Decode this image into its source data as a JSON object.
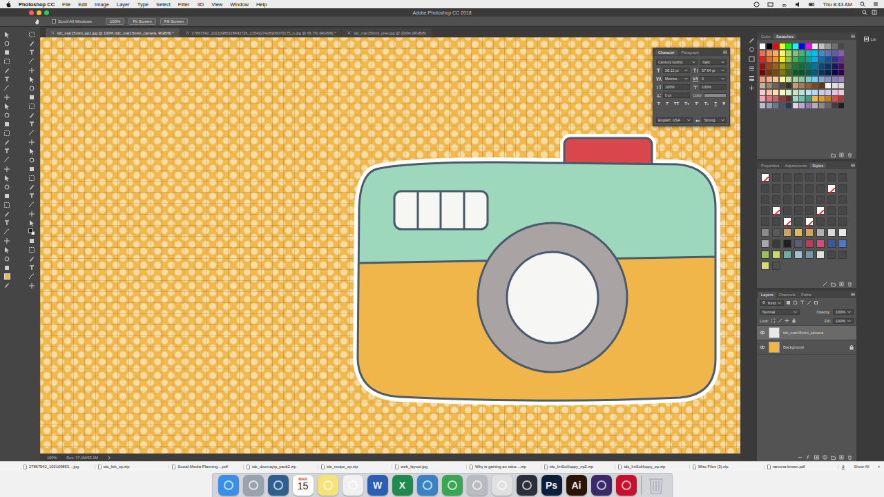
{
  "menubar": {
    "app": "Photoshop CC",
    "menus": [
      "File",
      "Edit",
      "Image",
      "Layer",
      "Type",
      "Select",
      "Filter",
      "3D",
      "View",
      "Window",
      "Help"
    ],
    "clock": "Thu 8:43 AM"
  },
  "window": {
    "title": "Adobe Photoshop CC 2018"
  },
  "options": {
    "scroll_all": {
      "label": "Scroll All Windows",
      "checked": false
    },
    "buttons": [
      "100%",
      "Fit Screen",
      "Fill Screen"
    ]
  },
  "tabs": [
    {
      "label": "tdc_mar15mini_pp1.jpg @ 100% (tdc_mar15mini_camera, RGB/8) *",
      "selected": true
    },
    {
      "label": "27867542_10210985328493726_2154327426906070175_n.jpg @ 66.7% (RGB/8) *",
      "selected": false
    },
    {
      "label": "tdc_mar15mini_prev.jpg @ 100% (RGB/8)",
      "selected": false
    }
  ],
  "character": {
    "tabs": [
      {
        "label": "Character",
        "selected": true
      },
      {
        "label": "Paragraph",
        "selected": false
      }
    ],
    "font": "Century Gothic",
    "style": "Italic",
    "size": "58.12 pt",
    "leading": "57.64 pt",
    "kerning": "Metrics",
    "tracking": "0",
    "vscale": "100%",
    "hscale": "100%",
    "baseline": "0 pt",
    "color_label": "Color:",
    "type_buttons": [
      "T",
      "T",
      "TT",
      "Tт",
      "T¹",
      "T₁",
      "T",
      "T"
    ],
    "language": "English: USA",
    "antialias": "Strong"
  },
  "swatches_panel": {
    "tabs": [
      {
        "label": "Color",
        "selected": false
      },
      {
        "label": "Swatches",
        "selected": true
      }
    ],
    "swatches": [
      {
        "color": "#ffffff"
      },
      {
        "color": "#000000"
      },
      {
        "color": "#ff0000"
      },
      {
        "color": "#ffff00"
      },
      {
        "color": "#00ff00"
      },
      {
        "color": "#00ffff"
      },
      {
        "color": "#0000ff"
      },
      {
        "color": "#ff00ff"
      },
      {
        "color": "#ebebeb"
      },
      {
        "color": "#c2c2c2"
      },
      {
        "color": "#999999"
      },
      {
        "color": "#707070"
      },
      {
        "color": "#474747"
      },
      {
        "color": "#f26c4f"
      },
      {
        "color": "#f68e55"
      },
      {
        "color": "#fbaf5c"
      },
      {
        "color": "#fff467"
      },
      {
        "color": "#acd372"
      },
      {
        "color": "#7cc576"
      },
      {
        "color": "#3bb878"
      },
      {
        "color": "#1abbb4"
      },
      {
        "color": "#00bff3"
      },
      {
        "color": "#438ccb"
      },
      {
        "color": "#5574b9"
      },
      {
        "color": "#605ca8"
      },
      {
        "color": "#855fa8"
      },
      {
        "color": "#ed1c24"
      },
      {
        "color": "#f26522"
      },
      {
        "color": "#f7941d"
      },
      {
        "color": "#fff200"
      },
      {
        "color": "#8dc63f"
      },
      {
        "color": "#39b54a"
      },
      {
        "color": "#00a651"
      },
      {
        "color": "#00a99d"
      },
      {
        "color": "#00aeef"
      },
      {
        "color": "#0072bc"
      },
      {
        "color": "#0054a6"
      },
      {
        "color": "#2e3192"
      },
      {
        "color": "#662d91"
      },
      {
        "color": "#9e0b0f"
      },
      {
        "color": "#a0410d"
      },
      {
        "color": "#a36209"
      },
      {
        "color": "#aba000"
      },
      {
        "color": "#598527"
      },
      {
        "color": "#1a7b30"
      },
      {
        "color": "#007236"
      },
      {
        "color": "#00746b"
      },
      {
        "color": "#0076a3"
      },
      {
        "color": "#004b80"
      },
      {
        "color": "#003471"
      },
      {
        "color": "#1b1464"
      },
      {
        "color": "#440e62"
      },
      {
        "color": "#790000"
      },
      {
        "color": "#7b2e00"
      },
      {
        "color": "#7d4900"
      },
      {
        "color": "#827b00"
      },
      {
        "color": "#406618"
      },
      {
        "color": "#005e20"
      },
      {
        "color": "#005826"
      },
      {
        "color": "#005952"
      },
      {
        "color": "#005b7f"
      },
      {
        "color": "#003663"
      },
      {
        "color": "#002157"
      },
      {
        "color": "#0d004c"
      },
      {
        "color": "#32004b"
      },
      {
        "color": "#f7977a"
      },
      {
        "color": "#f9ad81"
      },
      {
        "color": "#fdc68a"
      },
      {
        "color": "#fff79a"
      },
      {
        "color": "#c4df9b"
      },
      {
        "color": "#a3d39c"
      },
      {
        "color": "#82ca9d"
      },
      {
        "color": "#7accc8"
      },
      {
        "color": "#6dcff6"
      },
      {
        "color": "#7da7d9"
      },
      {
        "color": "#8393ca"
      },
      {
        "color": "#8781bd"
      },
      {
        "color": "#a186be"
      },
      {
        "color": "#c7b299"
      },
      {
        "color": "#998675"
      },
      {
        "color": "#736357"
      },
      {
        "color": "#534741"
      },
      {
        "color": "#37302d"
      },
      {
        "color": "#c69c6d"
      },
      {
        "color": "#a67c52"
      },
      {
        "color": "#8c6239"
      },
      {
        "color": "#754c24"
      },
      {
        "color": "#603913"
      },
      {
        "color": "#f5f5f5"
      },
      {
        "color": "#e0e0e0"
      },
      {
        "color": "#d7d7d7"
      },
      {
        "color": "#fbc9d6"
      },
      {
        "color": "#f9c3a3"
      },
      {
        "color": "#fde2a7"
      },
      {
        "color": "#fff9c4"
      },
      {
        "color": "#d8eec4"
      },
      {
        "color": "#c5e6c8"
      },
      {
        "color": "#b9e2d7"
      },
      {
        "color": "#b3e5f3"
      },
      {
        "color": "#b8d9f3"
      },
      {
        "color": "#c4cde9"
      },
      {
        "color": "#d1c6e4"
      },
      {
        "color": "#e6c3e0"
      },
      {
        "color": "#f5c4d8"
      },
      {
        "color": "#f4a6b6"
      },
      {
        "color": "#e7717d"
      },
      {
        "color": "#c96567"
      },
      {
        "color": "#8b3a3a"
      },
      {
        "color": "#5d2f2f"
      },
      {
        "color": "#9fd9c2"
      },
      {
        "color": "#6cc5a7"
      },
      {
        "color": "#3e9e83"
      },
      {
        "color": "#f0b64a"
      },
      {
        "color": "#e59b2d"
      },
      {
        "color": "#c97e1e"
      },
      {
        "color": "#dd4b44"
      },
      {
        "color": "#a83b3a"
      },
      {
        "color": "#b5bfcc"
      },
      {
        "color": "#8fa1b3"
      },
      {
        "color": "#667b92"
      },
      {
        "color": "#44576d"
      },
      {
        "color": "#2b3949"
      },
      {
        "color": "#e0d3ee"
      },
      {
        "color": "#bda5d6"
      },
      {
        "color": "#9479b8"
      },
      {
        "color": "#b0b0b0"
      },
      {
        "color": "#8a8a8a"
      },
      {
        "color": "#656565"
      },
      {
        "color": "#3e3e3e"
      },
      {
        "color": "#1f1f1f"
      }
    ]
  },
  "styles_panel": {
    "tabs": [
      {
        "label": "Properties",
        "selected": false
      },
      {
        "label": "Adjustments",
        "selected": false
      },
      {
        "label": "Styles",
        "selected": true
      }
    ],
    "styles": [
      {
        "kind": "none"
      },
      {
        "kind": "empty"
      },
      {
        "kind": "empty"
      },
      {
        "kind": "empty"
      },
      {
        "kind": "empty"
      },
      {
        "kind": "empty"
      },
      {
        "kind": "empty"
      },
      {
        "kind": "empty"
      },
      {
        "kind": "empty"
      },
      {
        "kind": "empty"
      },
      {
        "kind": "empty"
      },
      {
        "kind": "empty"
      },
      {
        "kind": "empty"
      },
      {
        "kind": "empty"
      },
      {
        "kind": "none"
      },
      {
        "kind": "empty"
      },
      {
        "kind": "empty"
      },
      {
        "kind": "empty"
      },
      {
        "kind": "empty"
      },
      {
        "kind": "empty"
      },
      {
        "kind": "empty"
      },
      {
        "kind": "empty"
      },
      {
        "kind": "empty"
      },
      {
        "kind": "empty"
      },
      {
        "kind": "empty"
      },
      {
        "kind": "none"
      },
      {
        "kind": "empty"
      },
      {
        "kind": "empty"
      },
      {
        "kind": "empty"
      },
      {
        "kind": "none"
      },
      {
        "kind": "empty"
      },
      {
        "kind": "empty"
      },
      {
        "kind": "empty"
      },
      {
        "kind": "empty"
      },
      {
        "kind": "none"
      },
      {
        "kind": "empty"
      },
      {
        "kind": "none"
      },
      {
        "kind": "empty"
      },
      {
        "kind": "empty"
      },
      {
        "kind": "empty"
      },
      {
        "kind": "fill",
        "color": "#8a8a8a"
      },
      {
        "kind": "fill",
        "color": "#5a5a5a"
      },
      {
        "kind": "fill",
        "color": "#c9a36a"
      },
      {
        "kind": "fill",
        "color": "#e0b85a"
      },
      {
        "kind": "fill",
        "color": "#d7a35c"
      },
      {
        "kind": "fill",
        "color": "#b0b0b0"
      },
      {
        "kind": "fill",
        "color": "#d8d8d8"
      },
      {
        "kind": "fill",
        "color": "#e8e8e8"
      },
      {
        "kind": "fill",
        "color": "#a8a8a8"
      },
      {
        "kind": "fill",
        "color": "#3a3a3a"
      },
      {
        "kind": "fill",
        "color": "#202020"
      },
      {
        "kind": "fill",
        "color": "#5b5b7a"
      },
      {
        "kind": "fill",
        "color": "#c0385a"
      },
      {
        "kind": "fill",
        "color": "#d94c7a"
      },
      {
        "kind": "fill",
        "color": "#3d55a8"
      },
      {
        "kind": "fill",
        "color": "#4a7bd0"
      },
      {
        "kind": "fill",
        "color": "#9cc05a"
      },
      {
        "kind": "fill",
        "color": "#c8d86a"
      },
      {
        "kind": "fill",
        "color": "#6ab0a0"
      },
      {
        "kind": "fill",
        "color": "#a0c0d0"
      },
      {
        "kind": "fill",
        "color": "#7098a8"
      },
      {
        "kind": "fill",
        "color": "#e0e0e0"
      },
      {
        "kind": "empty"
      },
      {
        "kind": "empty"
      },
      {
        "kind": "fill",
        "color": "#d8d87a"
      },
      {
        "kind": "fill",
        "color": "#505050"
      }
    ]
  },
  "layers_panel": {
    "tabs": [
      {
        "label": "Layers",
        "selected": true
      },
      {
        "label": "Channels",
        "selected": false
      },
      {
        "label": "Paths",
        "selected": false
      }
    ],
    "filter": "Kind",
    "blend": "Normal",
    "opacity_label": "Opacity:",
    "opacity": "100%",
    "lock_label": "Lock:",
    "fill_label": "Fill:",
    "fill": "100%",
    "layers": [
      {
        "name": "tdc_mar15mini_camera",
        "selected": true,
        "visible": true,
        "locked": false,
        "color": "#e8e8e8"
      },
      {
        "name": "Background",
        "selected": false,
        "visible": true,
        "locked": true,
        "color": "#f0b64a"
      }
    ]
  },
  "libraries": {
    "label": "Lib"
  },
  "status_bar": {
    "zoom": "100%",
    "doc": "Doc: 37.1M/53.1M"
  },
  "downloads": {
    "items": [
      "27867542_102109853....jpg",
      "tdc_feb_ep.zip",
      "Social-Media-Planning....pdf",
      "tdc_docmaytp_pack2.zip",
      "tdc_recipe_ep.zip",
      "web_layout.jpg",
      "Why is gaining an educ....zip",
      "tdc_ImSoHoppy_ep2.zip",
      "tdc_ImSoHoppy_ep.zip",
      "Misc Files (3).zip",
      "ramona brown.pdf"
    ],
    "show_all": "Show All",
    "close": "×"
  },
  "dock": {
    "items": [
      {
        "kind": "app",
        "glyph": "",
        "color": "#3a8ee6"
      },
      {
        "kind": "app",
        "glyph": "",
        "color": "#9aa3ad"
      },
      {
        "kind": "app",
        "glyph": "",
        "color": "#2f5f8f"
      },
      {
        "kind": "calendar",
        "glyph": "15",
        "sub": "MAR",
        "color": "#ffffff"
      },
      {
        "kind": "app",
        "glyph": "",
        "color": "#f7e27a"
      },
      {
        "kind": "app",
        "glyph": "",
        "color": "#f0f0f0"
      },
      {
        "kind": "app",
        "glyph": "W",
        "color": "#2b5fb4"
      },
      {
        "kind": "app",
        "glyph": "X",
        "color": "#1f8a4c"
      },
      {
        "kind": "app",
        "glyph": "",
        "color": "#3b82c4"
      },
      {
        "kind": "app",
        "glyph": "",
        "color": "#3aa655"
      },
      {
        "kind": "app",
        "glyph": "",
        "color": "#b8bcc2"
      },
      {
        "kind": "app",
        "glyph": "",
        "color": "#e0e0e0"
      },
      {
        "kind": "app",
        "glyph": "",
        "color": "#2a2f3a"
      },
      {
        "kind": "app",
        "glyph": "Ps",
        "color": "#0b1f3a"
      },
      {
        "kind": "app",
        "glyph": "Ai",
        "color": "#2d1400"
      },
      {
        "kind": "app",
        "glyph": "",
        "color": "#3a2a6a"
      },
      {
        "kind": "app",
        "glyph": "",
        "color": "#c8102e"
      },
      {
        "kind": "trash",
        "glyph": "",
        "color": "#cfd3d8"
      }
    ]
  }
}
